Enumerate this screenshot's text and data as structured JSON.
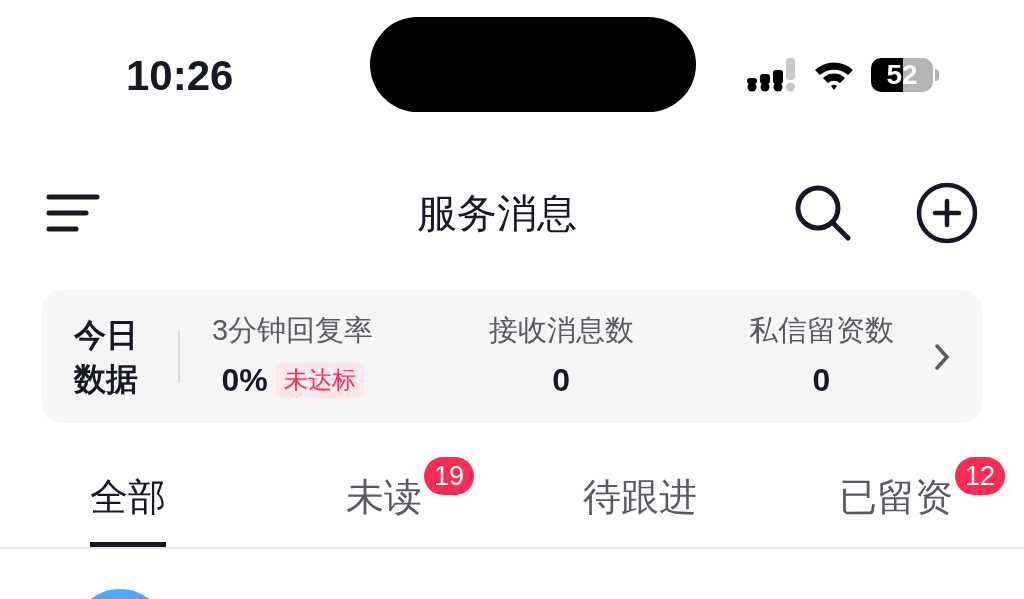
{
  "status_bar": {
    "time": "10:26",
    "battery": "52"
  },
  "header": {
    "title": "服务消息"
  },
  "stats": {
    "title": "今日数据",
    "items": [
      {
        "label": "3分钟回复率",
        "value": "0%",
        "badge": "未达标"
      },
      {
        "label": "接收消息数",
        "value": "0"
      },
      {
        "label": "私信留资数",
        "value": "0"
      }
    ]
  },
  "tabs": [
    {
      "label": "全部",
      "selected": true
    },
    {
      "label": "未读",
      "selected": false,
      "count": "19"
    },
    {
      "label": "待跟进",
      "selected": false
    },
    {
      "label": "已留资",
      "selected": false,
      "count": "12"
    }
  ],
  "conversations": [
    {
      "kind": "avatar"
    }
  ]
}
